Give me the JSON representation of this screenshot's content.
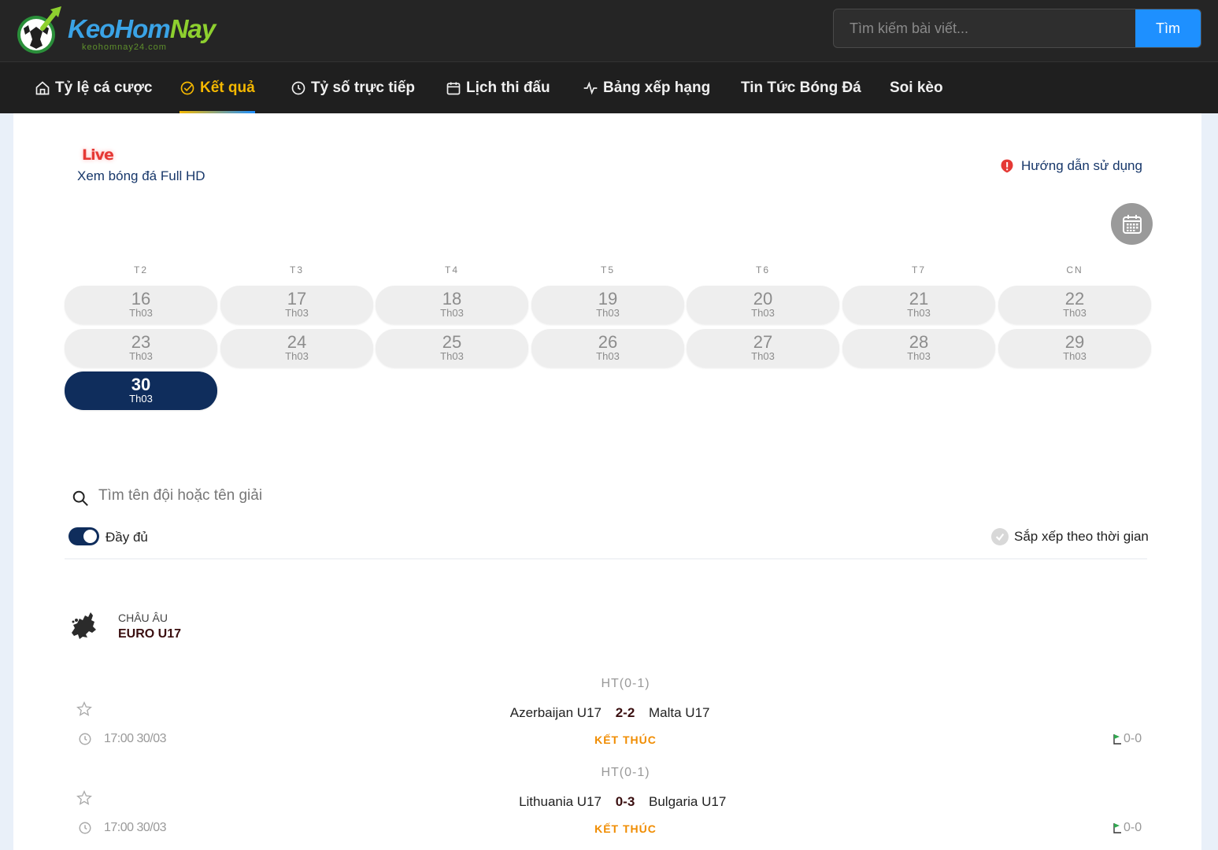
{
  "brand": {
    "part1": "KeoHom",
    "part2": "Nay",
    "domain": "keohomnay24.com"
  },
  "search": {
    "placeholder": "Tìm kiếm bài viết...",
    "button": "Tìm"
  },
  "nav": [
    {
      "label": "Tỷ lệ cá cược",
      "icon": "home-icon"
    },
    {
      "label": "Kết quả",
      "icon": "check-circle-icon",
      "active": true
    },
    {
      "label": "Tỷ số trực tiếp",
      "icon": "clock-icon"
    },
    {
      "label": "Lịch thi đấu",
      "icon": "calendar-icon"
    },
    {
      "label": "Bảng xếp hạng",
      "icon": "pulse-icon"
    },
    {
      "label": "Tin Tức Bóng Đá"
    },
    {
      "label": "Soi kèo"
    }
  ],
  "live": {
    "badge": "Live",
    "subtitle": "Xem bóng đá Full HD"
  },
  "guide": {
    "label": "Hướng dẫn sử dụng"
  },
  "weekdays": [
    "T2",
    "T3",
    "T4",
    "T5",
    "T6",
    "T7",
    "CN"
  ],
  "days": [
    {
      "num": "16",
      "month": "Th03"
    },
    {
      "num": "17",
      "month": "Th03"
    },
    {
      "num": "18",
      "month": "Th03"
    },
    {
      "num": "19",
      "month": "Th03"
    },
    {
      "num": "20",
      "month": "Th03"
    },
    {
      "num": "21",
      "month": "Th03"
    },
    {
      "num": "22",
      "month": "Th03"
    },
    {
      "num": "23",
      "month": "Th03"
    },
    {
      "num": "24",
      "month": "Th03"
    },
    {
      "num": "25",
      "month": "Th03"
    },
    {
      "num": "26",
      "month": "Th03"
    },
    {
      "num": "27",
      "month": "Th03"
    },
    {
      "num": "28",
      "month": "Th03"
    },
    {
      "num": "29",
      "month": "Th03"
    },
    {
      "num": "30",
      "month": "Th03",
      "selected": true
    }
  ],
  "filter": {
    "search_placeholder": "Tìm tên đội hoặc tên giải",
    "toggle_label": "Đầy đủ",
    "sort_label": "Sắp xếp theo thời gian"
  },
  "league": {
    "region": "CHÂU ÂU",
    "name": "EURO U17"
  },
  "matches": [
    {
      "ht": "HT(0-1)",
      "home": "Azerbaijan U17",
      "score": "2-2",
      "away": "Malta U17",
      "time": "17:00 30/03",
      "status": "KẾT THÚC",
      "corners": "0-0"
    },
    {
      "ht": "HT(0-1)",
      "home": "Lithuania U17",
      "score": "0-3",
      "away": "Bulgaria U17",
      "time": "17:00 30/03",
      "status": "KẾT THÚC",
      "corners": "0-0"
    }
  ],
  "colors": {
    "navy": "#0f2d5c",
    "accent_yellow": "#f5b800",
    "button_blue": "#1e90ff",
    "status_orange": "#f08c00",
    "live_red": "#e53935"
  }
}
